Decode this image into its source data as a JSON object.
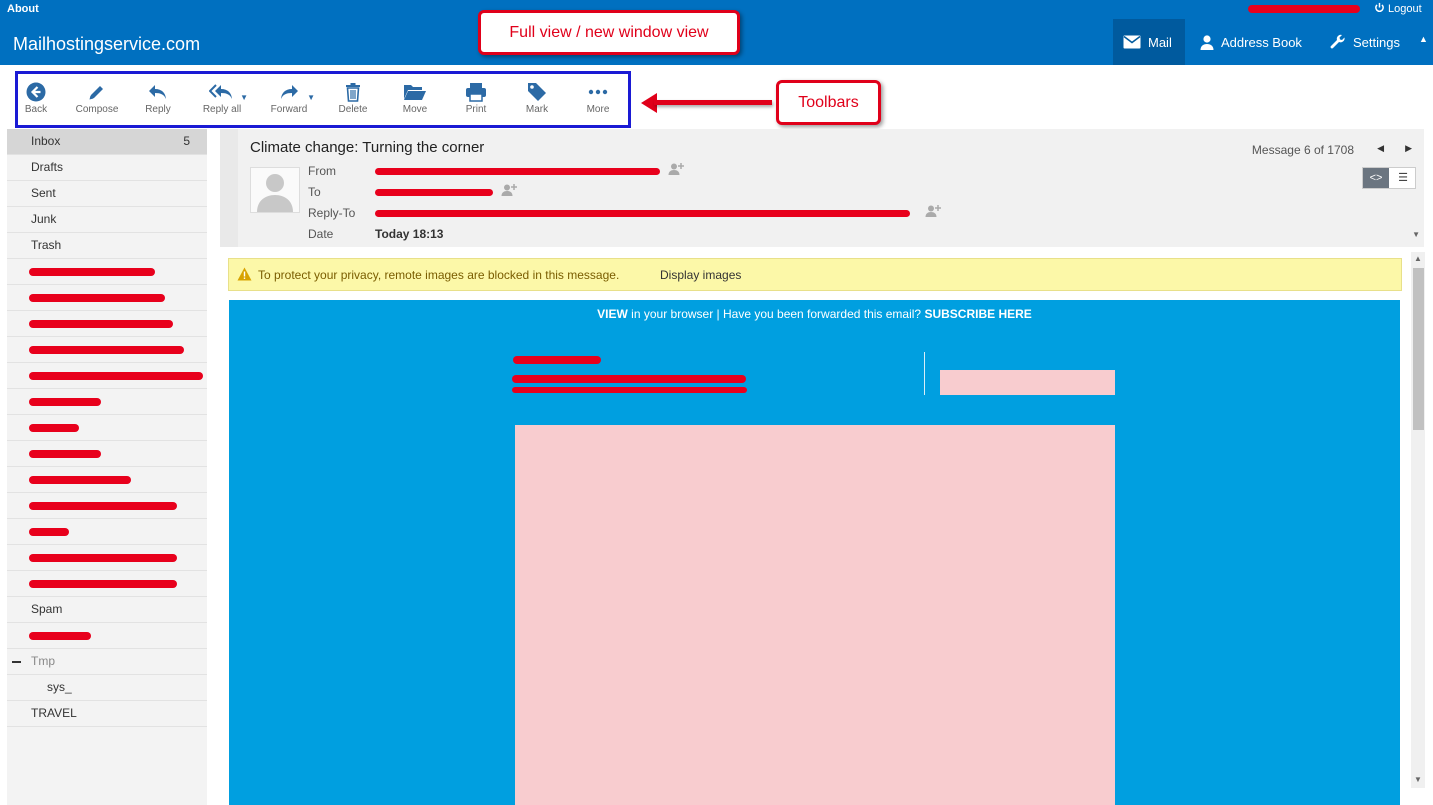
{
  "header": {
    "about": "About",
    "brand": "Mailhostingservice.com",
    "logout": "Logout",
    "nav": {
      "mail": "Mail",
      "address_book": "Address Book",
      "settings": "Settings"
    }
  },
  "toolbar": {
    "buttons": [
      {
        "label": "Back",
        "icon": "back-arrow-icon"
      },
      {
        "label": "Compose",
        "icon": "pencil-icon"
      },
      {
        "label": "Reply",
        "icon": "reply-icon"
      },
      {
        "label": "Reply all",
        "icon": "reply-all-icon"
      },
      {
        "label": "Forward",
        "icon": "forward-icon"
      },
      {
        "label": "Delete",
        "icon": "trash-icon"
      },
      {
        "label": "Move",
        "icon": "folder-open-icon"
      },
      {
        "label": "Print",
        "icon": "printer-icon"
      },
      {
        "label": "Mark",
        "icon": "tag-icon"
      },
      {
        "label": "More",
        "icon": "ellipsis-icon"
      }
    ]
  },
  "callouts": {
    "full_view": "Full view / new window view",
    "toolbars": "Toolbars"
  },
  "folders": {
    "inbox": {
      "label": "Inbox",
      "count": "5"
    },
    "drafts": "Drafts",
    "sent": "Sent",
    "junk": "Junk",
    "trash": "Trash",
    "spam": "Spam",
    "tmp": "Tmp",
    "sys": "sys_",
    "travel": "TRAVEL"
  },
  "message": {
    "subject": "Climate change: Turning the corner",
    "counter": "Message 6 of 1708",
    "labels": {
      "from": "From",
      "to": "To",
      "reply_to": "Reply-To",
      "date": "Date"
    },
    "date": "Today 18:13"
  },
  "notice": {
    "text": "To protect your privacy, remote images are blocked in this message.",
    "link": "Display images"
  },
  "mail_body": {
    "view": "VIEW",
    "in_browser": " in your browser | Have you been forwarded this email? ",
    "subscribe": "SUBSCRIBE HERE"
  },
  "colors": {
    "header": "#0070c0",
    "redaction": "#e8001c",
    "mail_background": "#009fe0",
    "blocked_image": "#f8cccf",
    "notice_background": "#fcf8a8"
  }
}
